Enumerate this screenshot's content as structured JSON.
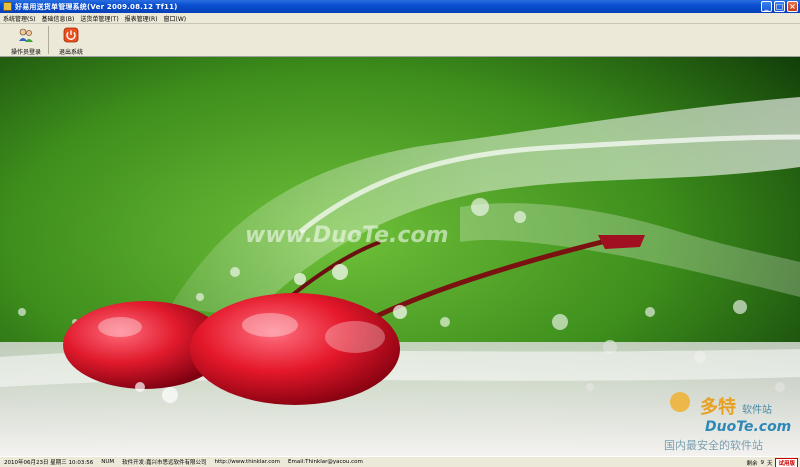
{
  "window": {
    "title": "好易用送货单管理系统(Ver 2009.08.12 Tf11)"
  },
  "menu": {
    "items": [
      {
        "label": "系统管理(S)"
      },
      {
        "label": "基础信息(B)"
      },
      {
        "label": "送货单管理(T)"
      },
      {
        "label": "报表管理(R)"
      },
      {
        "label": "窗口(W)"
      }
    ]
  },
  "toolbar": {
    "operator_login": "操作员登录",
    "exit_system": "退出系统"
  },
  "main": {
    "watermark": "www.DuoTe.com",
    "logo_cn": "多特",
    "logo_cn2": "软件站",
    "logo_en": "DuoTe.com",
    "logo_slogan": "国内最安全的软件站"
  },
  "status": {
    "date": "2010年06月23日 星期三 10:03:56",
    "num": "NUM",
    "developer": "软件开发:嘉兴市思远软件有限公司",
    "website": "http://www.thinklar.com",
    "email": "Email:Thinklar@yacou.com",
    "remaining_label": "剩余",
    "days": "9",
    "days_unit": "天",
    "trial_badge": "试用版"
  },
  "icons": {
    "app": "app-icon",
    "operator": "operator-login-icon",
    "exit": "power-icon"
  }
}
